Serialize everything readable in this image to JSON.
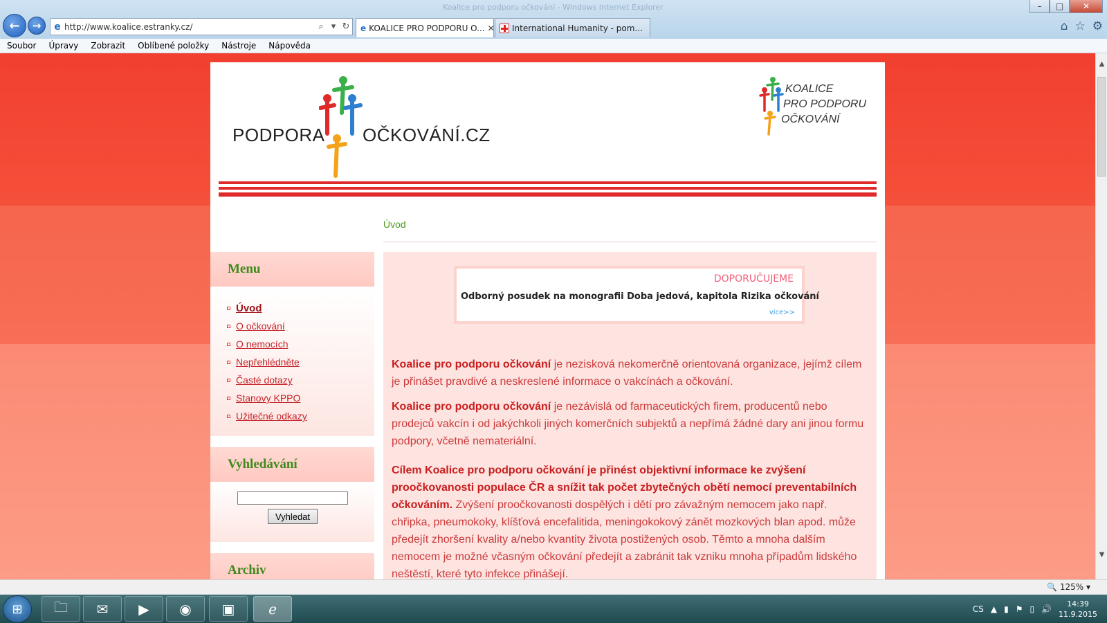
{
  "window": {
    "title": "Koalice pro podporu očkování - Windows Internet Explorer",
    "min": "–",
    "max": "□",
    "close": "✕"
  },
  "address": {
    "url": "http://www.koalice.estranky.cz/"
  },
  "tabs": [
    {
      "label": "KOALICE PRO PODPORU O...",
      "close": "✕"
    },
    {
      "label": "International Humanity - pom..."
    }
  ],
  "menubar": [
    "Soubor",
    "Úpravy",
    "Zobrazit",
    "Oblíbené položky",
    "Nástroje",
    "Nápověda"
  ],
  "header": {
    "logo_left": "PODPORA",
    "logo_right": "OČKOVÁNÍ.CZ",
    "small_logo": [
      "KOALICE",
      "PRO PODPORU",
      "OČKOVÁNÍ"
    ]
  },
  "breadcrumb": "Úvod",
  "sidebar": {
    "menu_title": "Menu",
    "menu_items": [
      {
        "label": "Úvod",
        "active": true
      },
      {
        "label": "O očkování"
      },
      {
        "label": "O nemocích"
      },
      {
        "label": "Nepřehlédněte"
      },
      {
        "label": "Časté dotazy"
      },
      {
        "label": "Stanovy KPPO"
      },
      {
        "label": "Užitečné odkazy"
      }
    ],
    "search_title": "Vyhledávání",
    "search_value": "",
    "search_button": "Vyhledat",
    "archive_title": "Archiv"
  },
  "banner": {
    "title": "DOPORUČUJEME",
    "text": "Odborný posudek na monografii Doba jedová, kapitola Rizika očkování",
    "more": "více>>"
  },
  "content": {
    "p1_bold": "Koalice pro podporu očkování",
    "p1_rest": " je nezisková nekomerčně orientovaná organizace, jejímž cílem je přinášet pravdivé a neskreslené informace o vakcínách a očkování.",
    "p2_bold": "Koalice pro podporu očkování",
    "p2_rest": " je nezávislá od farmaceutických firem, producentů nebo prodejců vakcín i od jakýchkoli jiných komerčních subjektů a nepřímá žádné dary ani jinou formu podpory, včetně nemateriální.",
    "p3_bold": "Cílem Koalice pro podporu očkování je přinést objektivní informace ke zvýšení proočkovanosti populace ČR a snížit tak počet zbytečných obětí nemocí preventabilních očkováním.",
    "p3_rest": " Zvýšení proočkovanosti dospělých i dětí pro závažným nemocem jako např. chřipka, pneumokoky, klíšťová encefalitida, meningokokový zánět mozkových blan apod. může předejít zhoršení kvality a/nebo kvantity života postižených osob. Těmto a mnoha dalším nemocem je možné včasným očkování předejít a zabránit tak vzniku mnoha případům lidského neštěstí, které tyto infekce přinášejí."
  },
  "statusbar": {
    "zoom": "125%"
  },
  "taskbar": {
    "lang": "CS",
    "time": "14:39",
    "date": "11.9.2015"
  },
  "colors": {
    "accent_red": "#c81e1e",
    "menu_green": "#3f8a1d",
    "banner_pink": "#f0607b"
  }
}
